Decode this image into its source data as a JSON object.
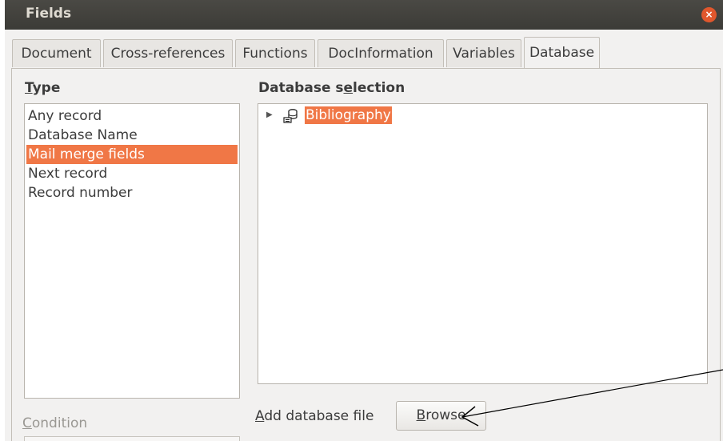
{
  "window": {
    "title": "Fields",
    "close_glyph": "×"
  },
  "tabs": [
    {
      "label": "Document"
    },
    {
      "label": "Cross-references"
    },
    {
      "label": "Functions"
    },
    {
      "label": "DocInformation"
    },
    {
      "label": "Variables"
    },
    {
      "label": "Database",
      "active": true
    }
  ],
  "type_section": {
    "heading_pre": "",
    "heading_mnemonic": "T",
    "heading_post": "ype",
    "items": [
      {
        "label": "Any record"
      },
      {
        "label": "Database Name"
      },
      {
        "label": "Mail merge fields",
        "selected": true
      },
      {
        "label": "Next record"
      },
      {
        "label": "Record number"
      }
    ]
  },
  "database_section": {
    "heading_pre": "Database s",
    "heading_mnemonic": "e",
    "heading_post": "lection",
    "tree": [
      {
        "label": "Bibliography",
        "icon": "database-icon",
        "expand_icon": "▶",
        "selected": true
      }
    ]
  },
  "add_database": {
    "label_pre": "",
    "label_mnemonic": "A",
    "label_post": "dd database file",
    "browse_pre": "",
    "browse_mnemonic": "B",
    "browse_post": "rowse"
  },
  "condition": {
    "label_pre": "",
    "label_mnemonic": "C",
    "label_post": "ondition"
  },
  "colors": {
    "selection": "#f07746",
    "titlebar": "#3c3b37",
    "close": "#e0572d"
  }
}
